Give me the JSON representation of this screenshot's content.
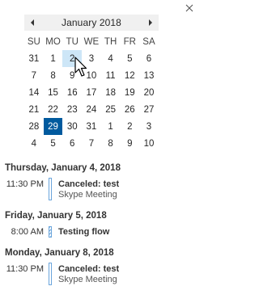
{
  "calendar": {
    "month_title": "January 2018",
    "weekdays": [
      "SU",
      "MO",
      "TU",
      "WE",
      "TH",
      "FR",
      "SA"
    ],
    "weeks": [
      [
        "31",
        "1",
        "2",
        "3",
        "4",
        "5",
        "6"
      ],
      [
        "7",
        "8",
        "9",
        "10",
        "11",
        "12",
        "13"
      ],
      [
        "14",
        "15",
        "16",
        "17",
        "18",
        "19",
        "20"
      ],
      [
        "21",
        "22",
        "23",
        "24",
        "25",
        "26",
        "27"
      ],
      [
        "28",
        "29",
        "30",
        "31",
        "1",
        "2",
        "3"
      ],
      [
        "4",
        "5",
        "6",
        "7",
        "8",
        "9",
        "10"
      ]
    ],
    "today_color": "#005a9e",
    "hover_color": "#cde6f7"
  },
  "agenda": {
    "days": [
      {
        "header": "Thursday, January 4, 2018",
        "events": [
          {
            "time": "11:30 PM",
            "title": "Canceled: test",
            "subtitle": "Skype Meeting"
          }
        ]
      },
      {
        "header": "Friday, January 5, 2018",
        "events": [
          {
            "time": "8:00 AM",
            "title": "Testing flow",
            "subtitle": ""
          }
        ]
      },
      {
        "header": "Monday, January 8, 2018",
        "events": [
          {
            "time": "11:30 PM",
            "title": "Canceled: test",
            "subtitle": "Skype Meeting"
          }
        ]
      }
    ],
    "event_bar_color": "#6aa5dc"
  },
  "icons": {
    "close": "close-icon",
    "prev": "chevron-left-icon",
    "next": "chevron-right-icon",
    "cursor": "mouse-pointer-icon"
  }
}
